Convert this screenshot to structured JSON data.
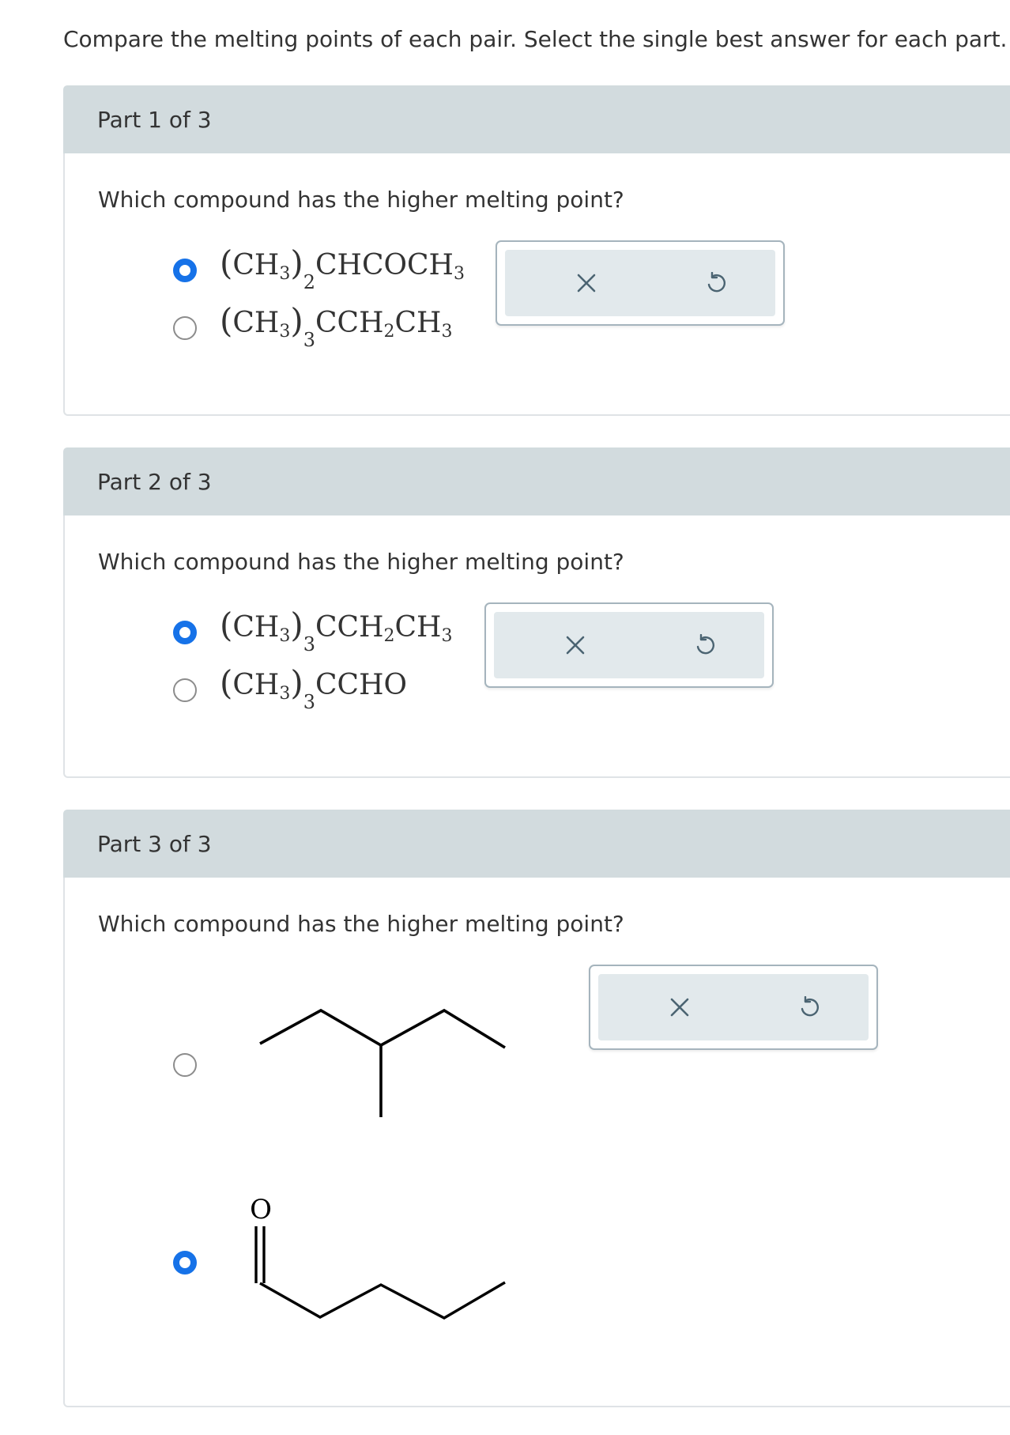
{
  "instructions": "Compare the melting points of each pair. Select the single best answer for each part.",
  "parts": [
    {
      "header": "Part 1 of 3",
      "question": "Which compound has the higher melting point?",
      "options": [
        {
          "selected": true,
          "formula_main": "CH",
          "formula_main_sub": "3",
          "group_sub": "2",
          "formula_rest": "CHCOCH",
          "formula_rest_sub": "3"
        },
        {
          "selected": false,
          "formula_main": "CH",
          "formula_main_sub": "3",
          "group_sub": "3",
          "formula_rest": "CCH",
          "formula_rest_sub": "2",
          "formula_tail": "CH",
          "formula_tail_sub": "3"
        }
      ]
    },
    {
      "header": "Part 2 of 3",
      "question": "Which compound has the higher melting point?",
      "options": [
        {
          "selected": true,
          "formula_main": "CH",
          "formula_main_sub": "3",
          "group_sub": "3",
          "formula_rest": "CCH",
          "formula_rest_sub": "2",
          "formula_tail": "CH",
          "formula_tail_sub": "3"
        },
        {
          "selected": false,
          "formula_main": "CH",
          "formula_main_sub": "3",
          "group_sub": "3",
          "formula_rest": "CCHO"
        }
      ]
    },
    {
      "header": "Part 3 of 3",
      "question": "Which compound has the higher melting point?",
      "options": [
        {
          "selected": false,
          "structure": "skeletal-branched-alkane"
        },
        {
          "selected": true,
          "structure": "skeletal-aldehyde",
          "atom_label": "O"
        }
      ]
    }
  ],
  "tools": {
    "clear_icon": "close-icon",
    "undo_icon": "undo-icon",
    "clear_symbol": "✕"
  },
  "colors": {
    "accent": "#1672e8",
    "header_bg": "#d2dbde",
    "tool_bg": "#e2e9ec",
    "tool_border": "#a5b4bd",
    "icon": "#4b6472"
  }
}
